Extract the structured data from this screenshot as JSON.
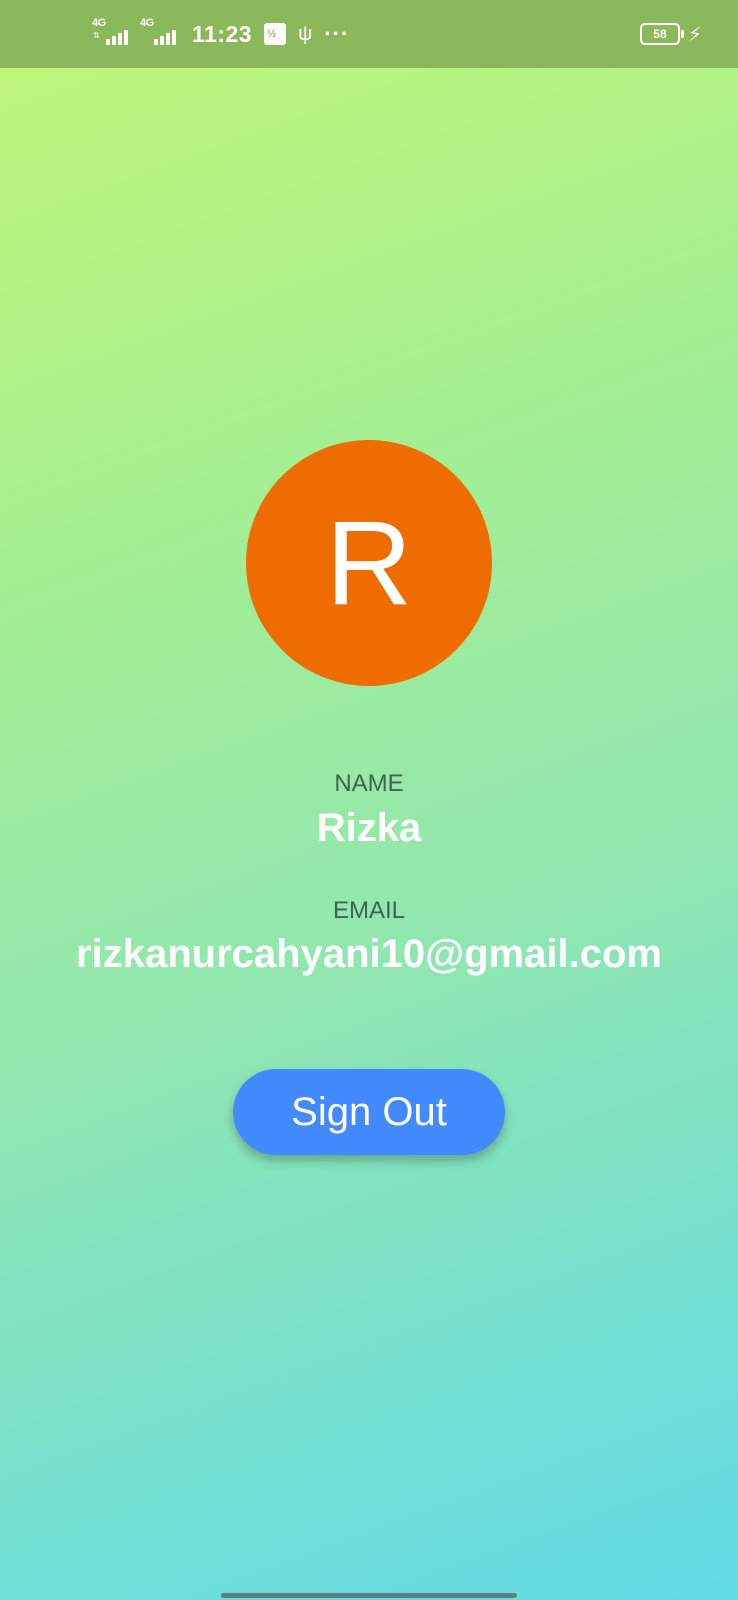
{
  "status_bar": {
    "network_1": "4G",
    "network_2": "4G",
    "time": "11:23",
    "more": "···",
    "battery_level": "58",
    "colors": {
      "background": "#8cb85c"
    }
  },
  "profile": {
    "avatar_initial": "R",
    "name_label": "NAME",
    "name": "Rizka",
    "email_label": "EMAIL",
    "email": "rizkanurcahyani10@gmail.com"
  },
  "actions": {
    "sign_out_label": "Sign Out"
  },
  "colors": {
    "avatar": "#ef6c00",
    "button": "#448aff",
    "label": "#3e6350",
    "gradient_top": "#c2f778",
    "gradient_bottom": "#62dbe8"
  }
}
